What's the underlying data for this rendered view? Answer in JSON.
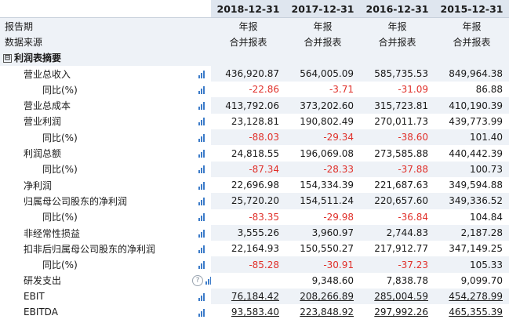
{
  "header": {
    "columns": [
      "2018-12-31",
      "2017-12-31",
      "2016-12-31",
      "2015-12-31"
    ]
  },
  "meta_rows": [
    {
      "label": "报告期",
      "values": [
        "年报",
        "年报",
        "年报",
        "年报"
      ]
    },
    {
      "label": "数据来源",
      "values": [
        "合并报表",
        "合并报表",
        "合并报表",
        "合并报表"
      ]
    }
  ],
  "section": {
    "toggle": "⊟",
    "label": "利润表摘要"
  },
  "rows": [
    {
      "label": "营业总收入",
      "indent": 1,
      "values": [
        "436,920.87",
        "564,005.09",
        "585,735.53",
        "849,964.38"
      ],
      "kind": "plain"
    },
    {
      "label": "同比(%)",
      "indent": 2,
      "values": [
        "-22.86",
        "-3.71",
        "-31.09",
        "86.88"
      ],
      "kind": "yoy"
    },
    {
      "label": "营业总成本",
      "indent": 1,
      "values": [
        "413,792.06",
        "373,202.60",
        "315,723.81",
        "410,190.39"
      ],
      "kind": "plain"
    },
    {
      "label": "营业利润",
      "indent": 1,
      "values": [
        "23,128.81",
        "190,802.49",
        "270,011.73",
        "439,773.99"
      ],
      "kind": "plain"
    },
    {
      "label": "同比(%)",
      "indent": 2,
      "values": [
        "-88.03",
        "-29.34",
        "-38.60",
        "101.40"
      ],
      "kind": "yoy"
    },
    {
      "label": "利润总额",
      "indent": 1,
      "values": [
        "24,818.55",
        "196,069.08",
        "273,585.88",
        "440,442.39"
      ],
      "kind": "plain"
    },
    {
      "label": "同比(%)",
      "indent": 2,
      "values": [
        "-87.34",
        "-28.33",
        "-37.88",
        "100.73"
      ],
      "kind": "yoy"
    },
    {
      "label": "净利润",
      "indent": 1,
      "values": [
        "22,696.98",
        "154,334.39",
        "221,687.63",
        "349,594.88"
      ],
      "kind": "plain"
    },
    {
      "label": "归属母公司股东的净利润",
      "indent": 1,
      "values": [
        "25,720.20",
        "154,511.24",
        "220,657.60",
        "349,336.52"
      ],
      "kind": "plain"
    },
    {
      "label": "同比(%)",
      "indent": 2,
      "values": [
        "-83.35",
        "-29.98",
        "-36.84",
        "104.84"
      ],
      "kind": "yoy"
    },
    {
      "label": "非经常性损益",
      "indent": 1,
      "values": [
        "3,555.26",
        "3,960.97",
        "2,744.83",
        "2,187.28"
      ],
      "kind": "plain"
    },
    {
      "label": "扣非后归属母公司股东的净利润",
      "indent": 1,
      "values": [
        "22,164.93",
        "150,550.27",
        "217,912.77",
        "347,149.25"
      ],
      "kind": "plain"
    },
    {
      "label": "同比(%)",
      "indent": 2,
      "values": [
        "-85.28",
        "-30.91",
        "-37.23",
        "105.33"
      ],
      "kind": "yoy"
    },
    {
      "label": "研发支出",
      "indent": 1,
      "values": [
        "",
        "9,348.60",
        "7,838.78",
        "9,099.70"
      ],
      "kind": "plain",
      "help": "?"
    },
    {
      "label": "EBIT",
      "indent": 1,
      "values": [
        "76,184.42",
        "208,266.89",
        "285,004.59",
        "454,278.99"
      ],
      "kind": "link"
    },
    {
      "label": "EBITDA",
      "indent": 1,
      "values": [
        "93,583.40",
        "223,848.92",
        "297,992.26",
        "465,355.39"
      ],
      "kind": "link"
    }
  ]
}
